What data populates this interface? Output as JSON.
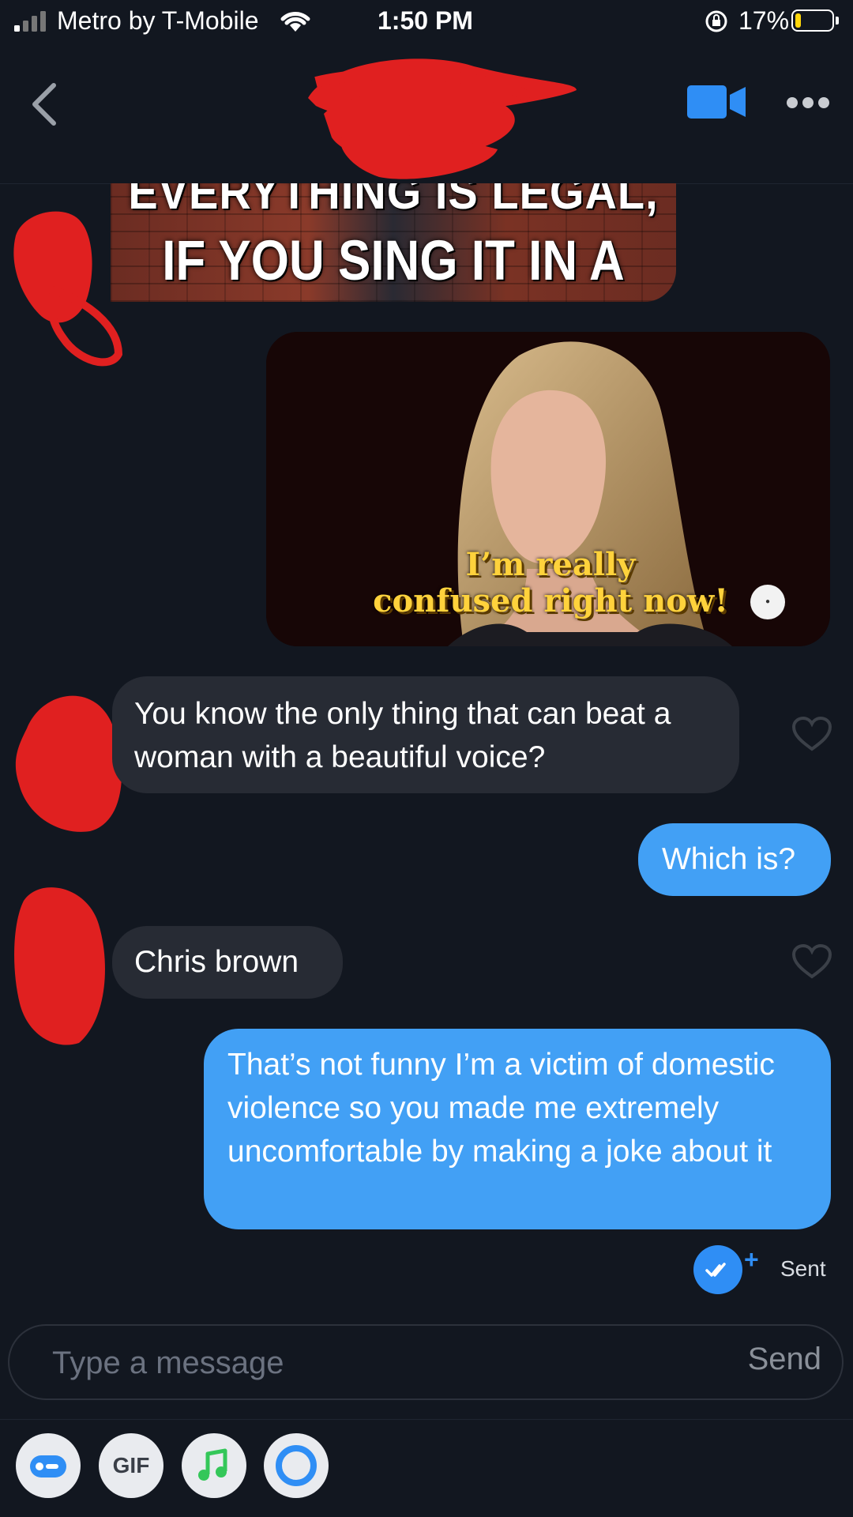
{
  "status_bar": {
    "carrier": "Metro by T-Mobile",
    "time": "1:50 PM",
    "battery_percent": "17%",
    "battery_level": 0.17
  },
  "header": {
    "back_icon": "chevron-left-icon",
    "video_icon": "video-camera-icon",
    "more_icon": "ellipsis-icon"
  },
  "messages": {
    "meme_legal": {
      "line1": "EVERYTHING IS LEGAL,",
      "line2": "IF YOU SING IT IN A SONG"
    },
    "gif_confused": {
      "line1": "I’m really",
      "line2": "confused right now!"
    },
    "m1": "You know the only thing that can beat a woman with a beautiful voice?",
    "m2": "Which is?",
    "m3": "Chris brown",
    "m4": "That’s not funny I’m a victim of domestic violence so you made me extremely uncomfortable by making a joke about it"
  },
  "receipt": {
    "status": "Sent",
    "plus": "+"
  },
  "composer": {
    "placeholder": "Type a message",
    "send_label": "Send"
  },
  "toolbar": {
    "gif_label": "GIF",
    "items": [
      "sticker-icon",
      "gif-button",
      "music-note-icon",
      "circle-icon"
    ]
  },
  "colors": {
    "background": "#121720",
    "incoming_bubble": "#272b34",
    "outgoing_bubble": "#42a0f5",
    "accent": "#2f8ef5",
    "redaction": "#e02020"
  }
}
